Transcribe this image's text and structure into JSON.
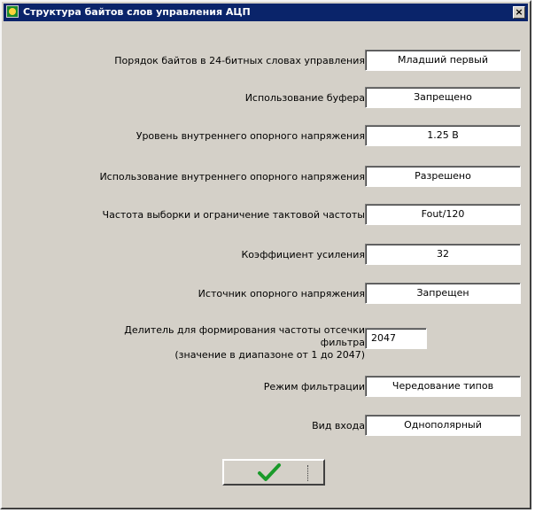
{
  "window": {
    "title": "Структура байтов слов управления АЦП",
    "close_label": "×",
    "icon": "app-icon"
  },
  "rows": [
    {
      "id": "byte-order",
      "label": "Порядок байтов в 24-битных словах управления",
      "value": "Младший первый"
    },
    {
      "id": "buffer-usage",
      "label": "Использование буфера",
      "value": "Запрещено"
    },
    {
      "id": "ref-voltage-level",
      "label": "Уровень внутреннего опорного напряжения",
      "value": "1.25 В"
    },
    {
      "id": "internal-ref-usage",
      "label": "Использование внутреннего опорного напряжения",
      "value": "Разрешено"
    },
    {
      "id": "sample-frequency",
      "label": "Частота выборки и ограничение тактовой частоты",
      "value": "Fout/120"
    },
    {
      "id": "gain",
      "label": "Коэффициент усиления",
      "value": "32"
    },
    {
      "id": "input-source",
      "label": "Источник опорного напряжения",
      "value": "Запрещен"
    },
    {
      "id": "decimation",
      "label": "Делитель для формирования частоты отсечки фильтра",
      "label2": "(значение в диапазоне от 1 до 2047)",
      "value": "2047"
    },
    {
      "id": "filter-mode",
      "label": "Режим фильтрации",
      "value": "Чередование типов"
    },
    {
      "id": "input-type",
      "label": "Вид входа",
      "value": "Однополярный"
    }
  ],
  "ok_button": {
    "icon": "checkmark-icon",
    "accent": "#1a9a2a"
  },
  "colors": {
    "titlebar": "#0a246a",
    "face": "#d4d0c8"
  }
}
